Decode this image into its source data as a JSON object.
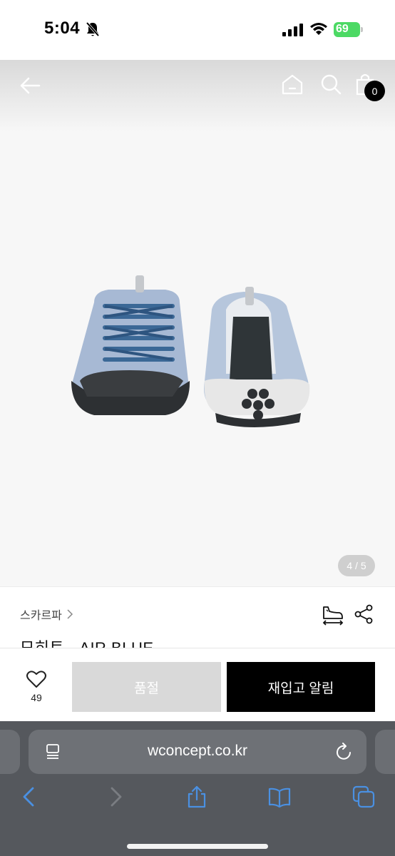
{
  "status_bar": {
    "time": "5:04",
    "battery_level": "69",
    "battery_color": "#4cd964",
    "icons": [
      "bell-slash-icon",
      "signal-icon",
      "wifi-icon",
      "battery-charging-icon"
    ]
  },
  "top_nav": {
    "icons": [
      "back-arrow-icon",
      "home-icon",
      "search-icon",
      "shopping-bag-icon"
    ],
    "cart_count": "0"
  },
  "gallery": {
    "image_counter": "4 / 5",
    "current_image": 4,
    "total_images": 5
  },
  "product": {
    "brand": "스카르파",
    "name": "모히토 - AIR BLUE",
    "icons": [
      "size-guide-icon",
      "share-icon"
    ]
  },
  "action_bar": {
    "like_count": "49",
    "soldout_label": "품절",
    "restock_label": "재입고 알림",
    "accent_color": "#000000",
    "disabled_color": "#d9d9d9"
  },
  "browser": {
    "url": "wconcept.co.kr",
    "toolbar_icons": [
      "back-icon",
      "forward-icon",
      "share-icon",
      "bookmarks-icon",
      "tabs-icon"
    ]
  }
}
